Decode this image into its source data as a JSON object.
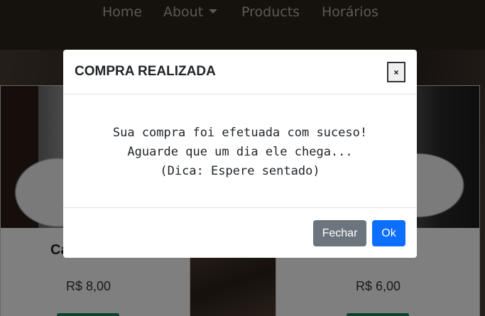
{
  "nav": {
    "items": [
      {
        "label": "Home"
      },
      {
        "label": "About"
      },
      {
        "label": "Products"
      },
      {
        "label": "Horários"
      }
    ]
  },
  "cards": [
    {
      "title": "Ca",
      "price": "R$ 8,00"
    },
    {
      "price": "R$ 6,00"
    }
  ],
  "modal": {
    "title": "COMPRA REALIZADA",
    "close_label": "×",
    "message_lines": [
      "Sua compra foi efetuada com suceso!",
      "Aguarde que um dia ele chega...",
      "(Dica: Espere sentado)"
    ],
    "buttons": {
      "close": "Fechar",
      "ok": "Ok"
    }
  },
  "colors": {
    "primary": "#0d6efd",
    "secondary": "#6c757d",
    "success": "#198754",
    "navbar": "#2a2218"
  }
}
